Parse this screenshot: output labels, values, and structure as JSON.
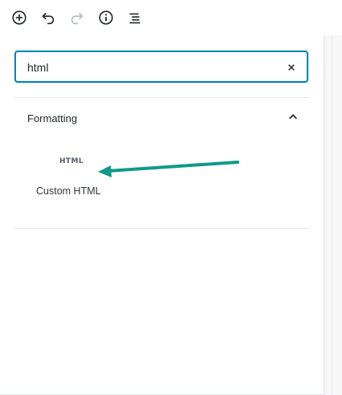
{
  "toolbar": {
    "buttons": [
      {
        "name": "add-block-button",
        "icon": "plus-circle-icon"
      },
      {
        "name": "undo-button",
        "icon": "undo-icon"
      },
      {
        "name": "redo-button",
        "icon": "redo-icon"
      },
      {
        "name": "info-button",
        "icon": "info-icon"
      },
      {
        "name": "outline-button",
        "icon": "list-outline-icon"
      }
    ]
  },
  "inserter": {
    "search": {
      "value": "html",
      "clear_icon": "close-icon"
    },
    "section": {
      "title": "Formatting",
      "toggle_icon": "chevron-up-icon"
    },
    "blocks": [
      {
        "icon_text": "HTML",
        "label": "Custom HTML"
      }
    ]
  },
  "annotation": {
    "arrow_color": "#10998a"
  },
  "colors": {
    "focus_border": "#0085ba",
    "text": "#23282d"
  }
}
